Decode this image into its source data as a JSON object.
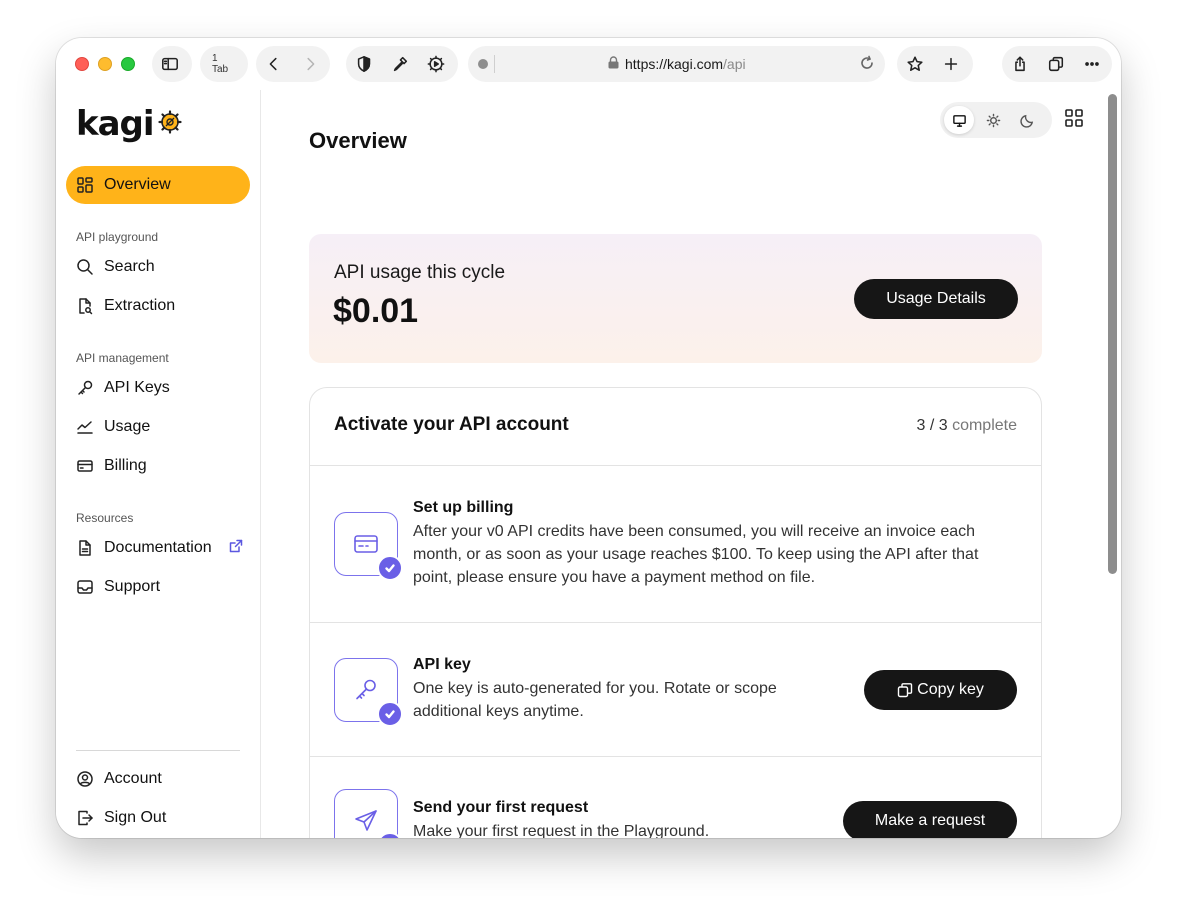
{
  "browser": {
    "tab_count": "1 Tab",
    "url_host": "https://kagi.com",
    "url_path": "/api"
  },
  "sidebar": {
    "logo": "kagi",
    "overview": "Overview",
    "section_playground": "API playground",
    "search": "Search",
    "extraction": "Extraction",
    "section_management": "API management",
    "api_keys": "API Keys",
    "usage": "Usage",
    "billing": "Billing",
    "section_resources": "Resources",
    "documentation": "Documentation",
    "support": "Support",
    "account": "Account",
    "sign_out": "Sign Out"
  },
  "main": {
    "title": "Overview",
    "usage": {
      "label": "API usage this cycle",
      "value": "$0.01",
      "button": "Usage Details"
    },
    "activate": {
      "title": "Activate your API account",
      "progress_count": "3 / 3",
      "progress_suffix": "complete",
      "steps": [
        {
          "title": "Set up billing",
          "description": "After your v0 API credits have been consumed, you will receive an invoice each month, or as soon as your usage reaches $100. To keep using the API after that point, please ensure you have a payment method on file."
        },
        {
          "title": "API key",
          "description": "One key is auto-generated for you. Rotate or scope additional keys anytime.",
          "button": "Copy key"
        },
        {
          "title": "Send your first request",
          "description": "Make your first request in the Playground.",
          "button": "Make a request"
        }
      ]
    }
  },
  "colors": {
    "accent": "#ffb319",
    "step_icon": "#6a5fe6",
    "button_dark": "#161616"
  }
}
